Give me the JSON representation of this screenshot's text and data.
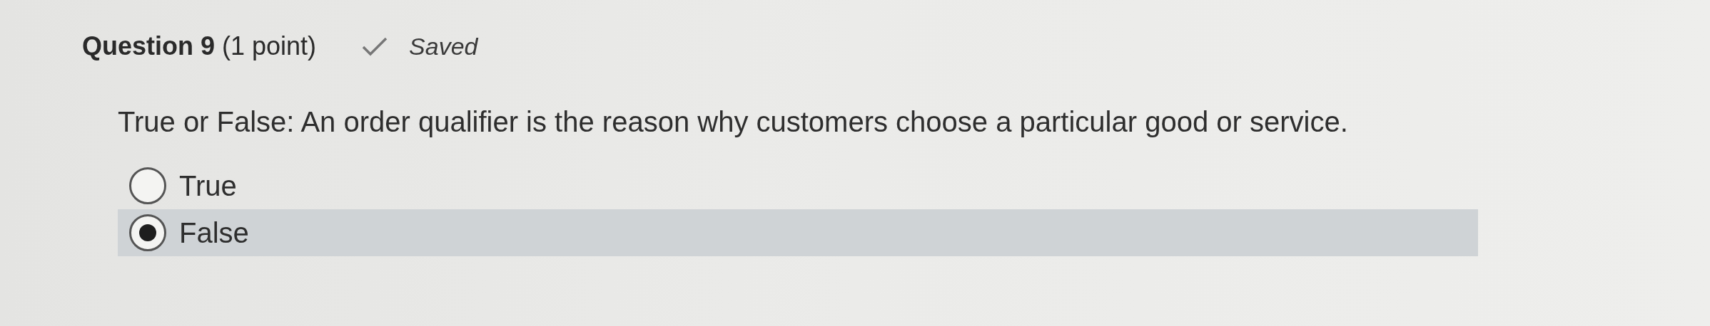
{
  "question": {
    "title": "Question 9",
    "points": "(1 point)",
    "status": "Saved",
    "saved": true,
    "prompt": "True or False: An order qualifier is the reason why customers choose a particular good or service."
  },
  "options": [
    {
      "label": "True",
      "selected": false
    },
    {
      "label": "False",
      "selected": true
    }
  ]
}
